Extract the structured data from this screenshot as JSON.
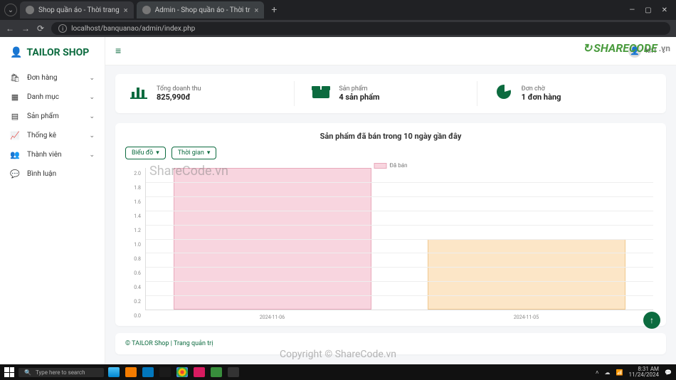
{
  "browser": {
    "tabs": [
      {
        "title": "Shop quần áo - Thời trang",
        "active": false
      },
      {
        "title": "Admin - Shop quần áo - Thời tr",
        "active": true
      }
    ],
    "url": "localhost/banquanao/admin/index.php"
  },
  "brand": "TAILOR SHOP",
  "sidebar": {
    "items": [
      {
        "icon": "🛍",
        "label": "Đơn hàng",
        "expandable": true
      },
      {
        "icon": "▦",
        "label": "Danh mục",
        "expandable": true
      },
      {
        "icon": "▤",
        "label": "Sản phẩm",
        "expandable": true
      },
      {
        "icon": "📈",
        "label": "Thống kê",
        "expandable": true
      },
      {
        "icon": "👥",
        "label": "Thành viên",
        "expandable": true
      },
      {
        "icon": "💬",
        "label": "Bình luận",
        "expandable": false
      }
    ]
  },
  "user": {
    "name": "kh1"
  },
  "stats": [
    {
      "icon": "bars",
      "title": "Tổng doanh thu",
      "value": "825,990đ"
    },
    {
      "icon": "box",
      "title": "Sản phẩm",
      "value": "4 sản phẩm"
    },
    {
      "icon": "pie",
      "title": "Đơn chờ",
      "value": "1 đơn hàng"
    }
  ],
  "chart_controls": {
    "type_label": "Biểu đồ",
    "time_label": "Thời gian"
  },
  "chart_data": {
    "type": "bar",
    "title": "Sản phẩm đã bán trong 10 ngày gần đây",
    "legend": "Đã bán",
    "categories": [
      "2024-11-06",
      "2024-11-05"
    ],
    "values": [
      2,
      1
    ],
    "ylim": [
      0,
      2
    ],
    "ystep": 0.2,
    "colors": [
      "#f8d5df",
      "#fce6c7"
    ]
  },
  "footer": "© TAILOR Shop | Trang quản trị",
  "watermarks": {
    "text": "ShareCode.vn",
    "copyright": "Copyright © ShareCode.vn",
    "logo": "SHARECODE",
    "logo_suffix": ".vn"
  },
  "taskbar": {
    "search_placeholder": "Type here to search",
    "time": "8:31 AM",
    "date": "11/24/2024"
  }
}
